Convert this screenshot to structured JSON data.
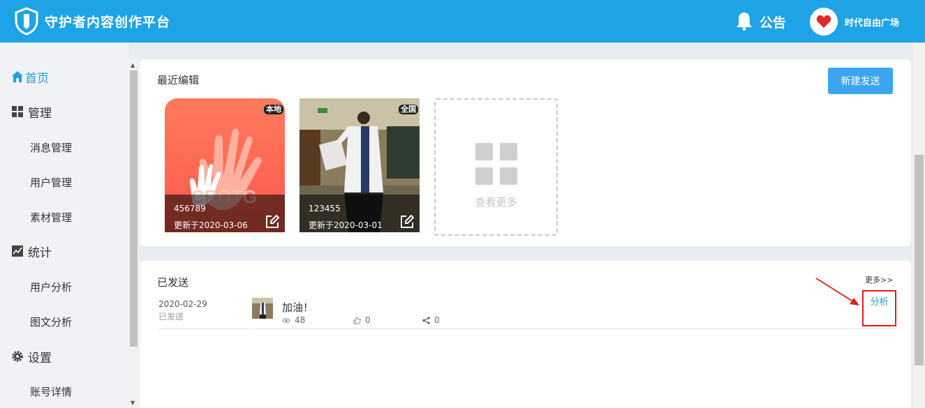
{
  "header": {
    "app_title": "守护者内容创作平台",
    "notice_label": "公告",
    "username": "时代自由广场"
  },
  "sidebar": {
    "home": "首页",
    "manage": "管理",
    "manage_items": [
      "消息管理",
      "用户管理",
      "素材管理"
    ],
    "stats": "统计",
    "stats_items": [
      "用户分析",
      "图文分析"
    ],
    "settings": "设置",
    "settings_items": [
      "账号详情"
    ]
  },
  "recent": {
    "title": "最近编辑",
    "new_button": "新建发送",
    "cards": [
      {
        "badge": "本地",
        "title": "456789",
        "date": "更新于2020-03-06"
      },
      {
        "badge": "全国",
        "title": "123455",
        "date": "更新于2020-03-01"
      }
    ],
    "more_label": "查看更多"
  },
  "sent": {
    "title": "已发送",
    "more_link": "更多>>",
    "items": [
      {
        "date": "2020-02-29",
        "status": "已发送",
        "title": "加油！",
        "views": "48",
        "likes": "0",
        "shares": "0",
        "analyze_label": "分析"
      }
    ]
  },
  "colors": {
    "header": "#1ea3e6",
    "accent": "#1e9fe8",
    "highlight": "#e31b1b"
  }
}
